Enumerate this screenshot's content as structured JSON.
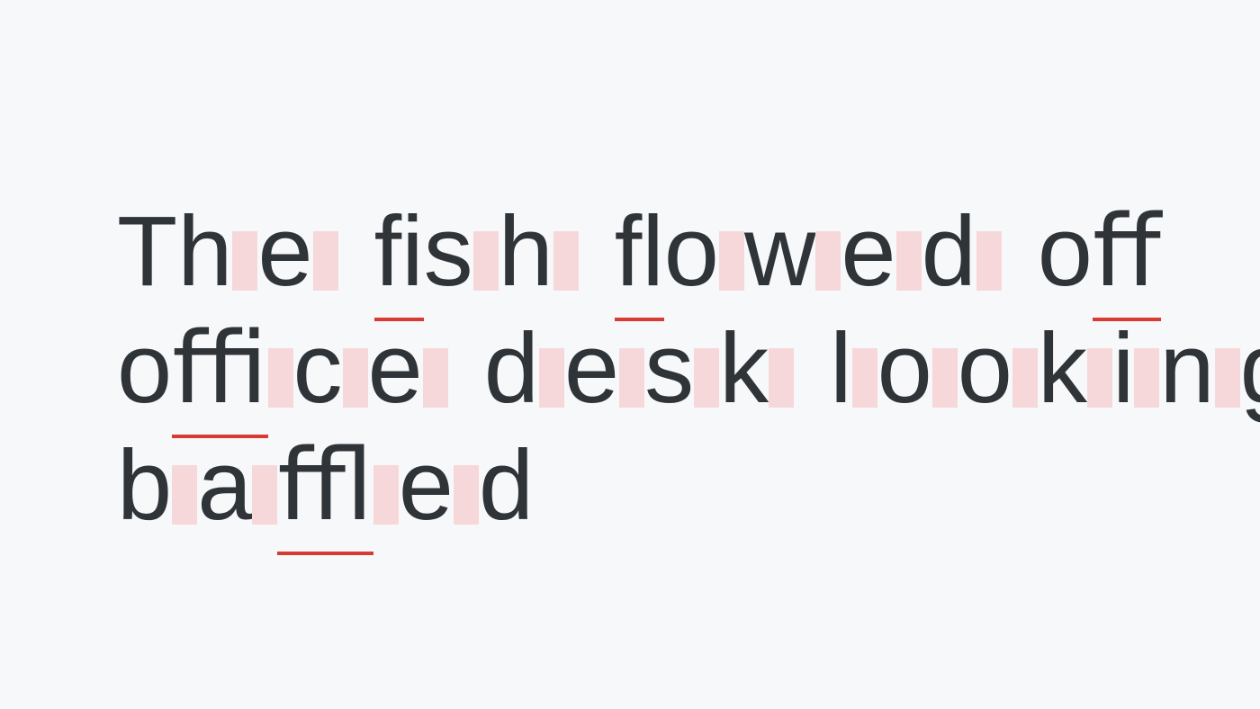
{
  "sentence": "The fish flowed off office desk looking baffled",
  "ligatures_underlined": [
    "fi",
    "fl",
    "ff",
    "ffi",
    "ffl"
  ],
  "colors": {
    "background": "#f7f8fa",
    "text": "#2f3439",
    "highlight": "#f6d8da",
    "underline": "#d83a34"
  },
  "lines": [
    [
      {
        "text": "T",
        "pad": false,
        "underline": false
      },
      {
        "text": "h",
        "pad": true,
        "underline": false
      },
      {
        "text": "e",
        "pad": true,
        "underline": false
      },
      {
        "space": true
      },
      {
        "text": "ﬁ",
        "pad": false,
        "underline": true,
        "plain": "fi"
      },
      {
        "text": "s",
        "pad": true,
        "underline": false
      },
      {
        "text": "h",
        "pad": true,
        "underline": false
      },
      {
        "space": true
      },
      {
        "text": "ﬂ",
        "pad": false,
        "underline": true,
        "plain": "fl"
      },
      {
        "text": "o",
        "pad": true,
        "underline": false
      },
      {
        "text": "w",
        "pad": true,
        "underline": false
      },
      {
        "text": "e",
        "pad": true,
        "underline": false
      },
      {
        "text": "d",
        "pad": true,
        "underline": false
      },
      {
        "space": true
      },
      {
        "text": "o",
        "pad": false,
        "underline": false
      },
      {
        "text": "ﬀ",
        "pad": false,
        "underline": true,
        "plain": "ff"
      }
    ],
    [
      {
        "text": "o",
        "pad": false,
        "underline": false
      },
      {
        "text": "ﬃ",
        "pad": true,
        "underline": true,
        "plain": "ffi"
      },
      {
        "text": "c",
        "pad": true,
        "underline": false
      },
      {
        "text": "e",
        "pad": true,
        "underline": false
      },
      {
        "space": true
      },
      {
        "text": "d",
        "pad": true,
        "underline": false
      },
      {
        "text": "e",
        "pad": true,
        "underline": false
      },
      {
        "text": "s",
        "pad": true,
        "underline": false
      },
      {
        "text": "k",
        "pad": true,
        "underline": false
      },
      {
        "space": true
      },
      {
        "text": "l",
        "pad": true,
        "underline": false
      },
      {
        "text": "o",
        "pad": true,
        "underline": false
      },
      {
        "text": "o",
        "pad": true,
        "underline": false
      },
      {
        "text": "k",
        "pad": true,
        "underline": false
      },
      {
        "text": "i",
        "pad": true,
        "underline": false
      },
      {
        "text": "n",
        "pad": true,
        "underline": false
      },
      {
        "text": "g",
        "pad": true,
        "underline": false
      }
    ],
    [
      {
        "text": "b",
        "pad": true,
        "underline": false
      },
      {
        "text": "a",
        "pad": true,
        "underline": false
      },
      {
        "text": "ﬄ",
        "pad": true,
        "underline": true,
        "plain": "ffl"
      },
      {
        "text": "e",
        "pad": true,
        "underline": false
      },
      {
        "text": "d",
        "pad": false,
        "underline": false
      }
    ]
  ]
}
